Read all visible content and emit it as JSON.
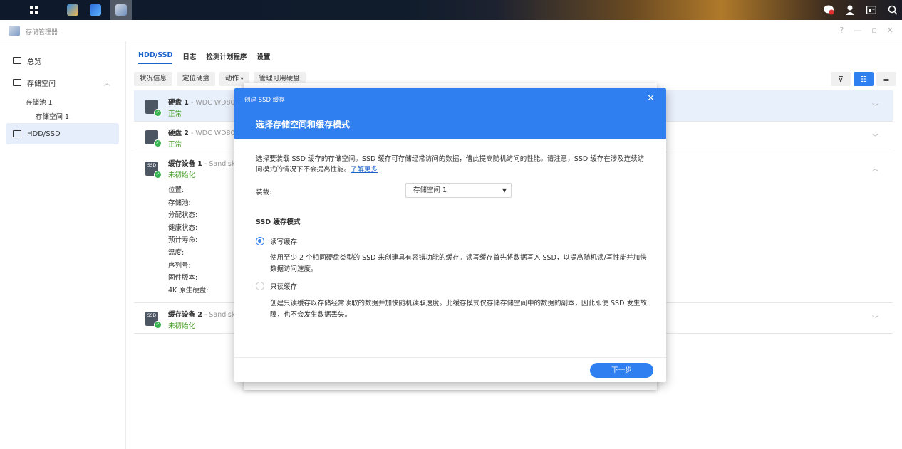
{
  "window": {
    "title": "存储管理器"
  },
  "sidebar": {
    "items": [
      {
        "label": "总览"
      },
      {
        "label": "存储空间"
      },
      {
        "label": "HDD/SSD"
      }
    ],
    "sub": {
      "pool": "存储池 1",
      "volume": "存储空间 1"
    }
  },
  "tabs": [
    "HDD/SSD",
    "日志",
    "检测计划程序",
    "设置"
  ],
  "toolbar": {
    "status": "状况信息",
    "locate": "定位硬盘",
    "action": "动作",
    "manage": "管理可用硬盘"
  },
  "drives": [
    {
      "name": "硬盘 1",
      "model": " - WDC WD80",
      "status": "正常"
    },
    {
      "name": "硬盘 2",
      "model": " - WDC WD80",
      "status": "正常"
    },
    {
      "name": "缓存设备 1",
      "model": " - Sandisk",
      "status": "未初始化",
      "icon_text": "SSD",
      "details": [
        "位置:",
        "存储池:",
        "分配状态:",
        "健康状态:",
        "预计寿命:",
        "温度:",
        "序列号:",
        "固件版本:",
        "4K 原生硬盘:"
      ]
    },
    {
      "name": "缓存设备 2",
      "model": " - Sandisk",
      "status": "未初始化",
      "icon_text": "SSD"
    }
  ],
  "dialog": {
    "small_title": "创建 SSD 缓存",
    "title": "选择存储空间和缓存模式",
    "intro": "选择要装载 SSD 缓存的存储空间。SSD 缓存可存储经常访问的数据，借此提高随机访问的性能。请注意，SSD 缓存在涉及连续访问模式的情况下不会提高性能。",
    "learn_more": "了解更多",
    "mount_label": "装载:",
    "mount_value": "存储空间 1",
    "mode_title": "SSD 缓存模式",
    "rw_label": "读写缓存",
    "rw_desc": "使用至少 2 个相同硬盘类型的 SSD 来创建具有容错功能的缓存。读写缓存首先将数据写入 SSD，以提高随机读/写性能并加快数据访问速度。",
    "ro_label": "只读缓存",
    "ro_desc": "创建只读缓存以存储经常读取的数据并加快随机读取速度。此缓存模式仅存储存储空间中的数据的副本，因此即使 SSD 发生故障，也不会发生数据丢失。",
    "next": "下一步"
  }
}
